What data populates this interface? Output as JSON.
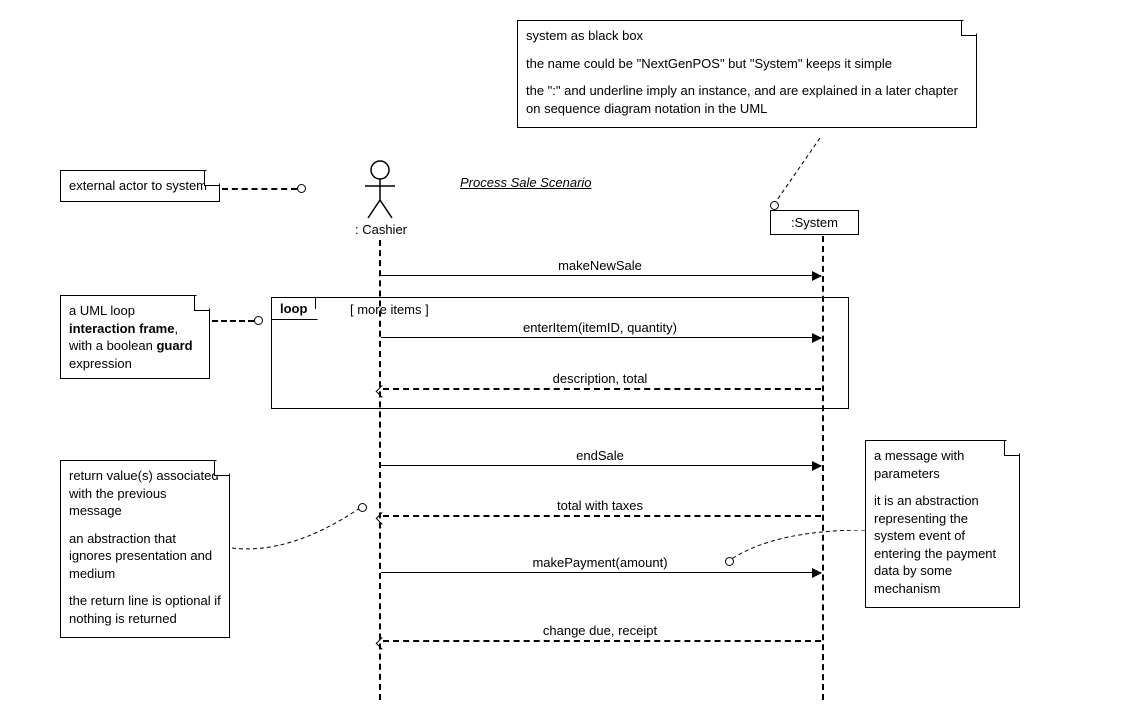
{
  "title": "Process Sale Scenario",
  "actor_label": ": Cashier",
  "system_label": ":System",
  "loop": {
    "label": "loop",
    "guard": "[ more items ]"
  },
  "messages": {
    "m1": "makeNewSale",
    "m2": "enterItem(itemID, quantity)",
    "r2": "description, total",
    "m3": "endSale",
    "r3": "total with taxes",
    "m4": "makePayment(amount)",
    "r4": "change due, receipt"
  },
  "notes": {
    "n1": "external actor to system",
    "n2_l1": "system as black box",
    "n2_l2": "the name could be \"NextGenPOS\" but \"System\" keeps it simple",
    "n2_l3": "the \":\" and underline imply an instance, and are explained in a later chapter on sequence diagram notation in the UML",
    "n3_pre": "a UML loop ",
    "n3_bold1": "interaction frame",
    "n3_mid": ", with a boolean ",
    "n3_bold2": "guard",
    "n3_post": " expression",
    "n4_l1": "return value(s) associated with the previous message",
    "n4_l2": "an abstraction that ignores presentation and medium",
    "n4_l3": "the return line is optional if nothing is returned",
    "n5_l1": "a message with parameters",
    "n5_l2": "it is an abstraction representing the system event of entering the payment data by some mechanism"
  }
}
